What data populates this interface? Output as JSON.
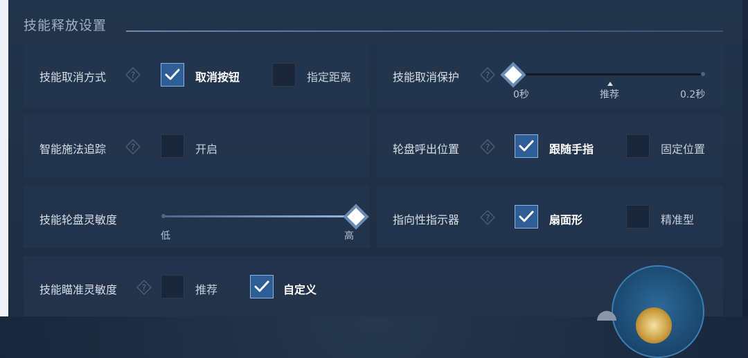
{
  "title": "技能释放设置",
  "colors": {
    "accent": "#2f5d96",
    "checked_border": "#8cb4e6",
    "panel": "#24364e"
  },
  "rows": {
    "cancel_method": {
      "label": "技能取消方式",
      "opt1": "取消按钮",
      "opt1_checked": true,
      "opt2": "指定距离",
      "opt2_checked": false
    },
    "cancel_protect": {
      "label": "技能取消保护",
      "min": "0秒",
      "mid": "推荐",
      "max": "0.2秒",
      "value_fraction": 0.0
    },
    "smart_cast": {
      "label": "智能施法追踪",
      "opt1": "开启",
      "opt1_checked": false
    },
    "wheel_position": {
      "label": "轮盘呼出位置",
      "opt1": "跟随手指",
      "opt1_checked": true,
      "opt2": "固定位置",
      "opt2_checked": false
    },
    "wheel_sensitivity": {
      "label": "技能轮盘灵敏度",
      "min": "低",
      "max": "高",
      "value_fraction": 1.0
    },
    "indicator": {
      "label": "指向性指示器",
      "opt1": "扇面形",
      "opt1_checked": true,
      "opt2": "精准型",
      "opt2_checked": false
    },
    "aim_sensitivity": {
      "label": "技能瞄准灵敏度",
      "opt1": "推荐",
      "opt1_checked": false,
      "opt2": "自定义",
      "opt2_checked": true
    }
  },
  "icons": {
    "help": "help-diamond-icon",
    "check": "checkmark-icon"
  }
}
